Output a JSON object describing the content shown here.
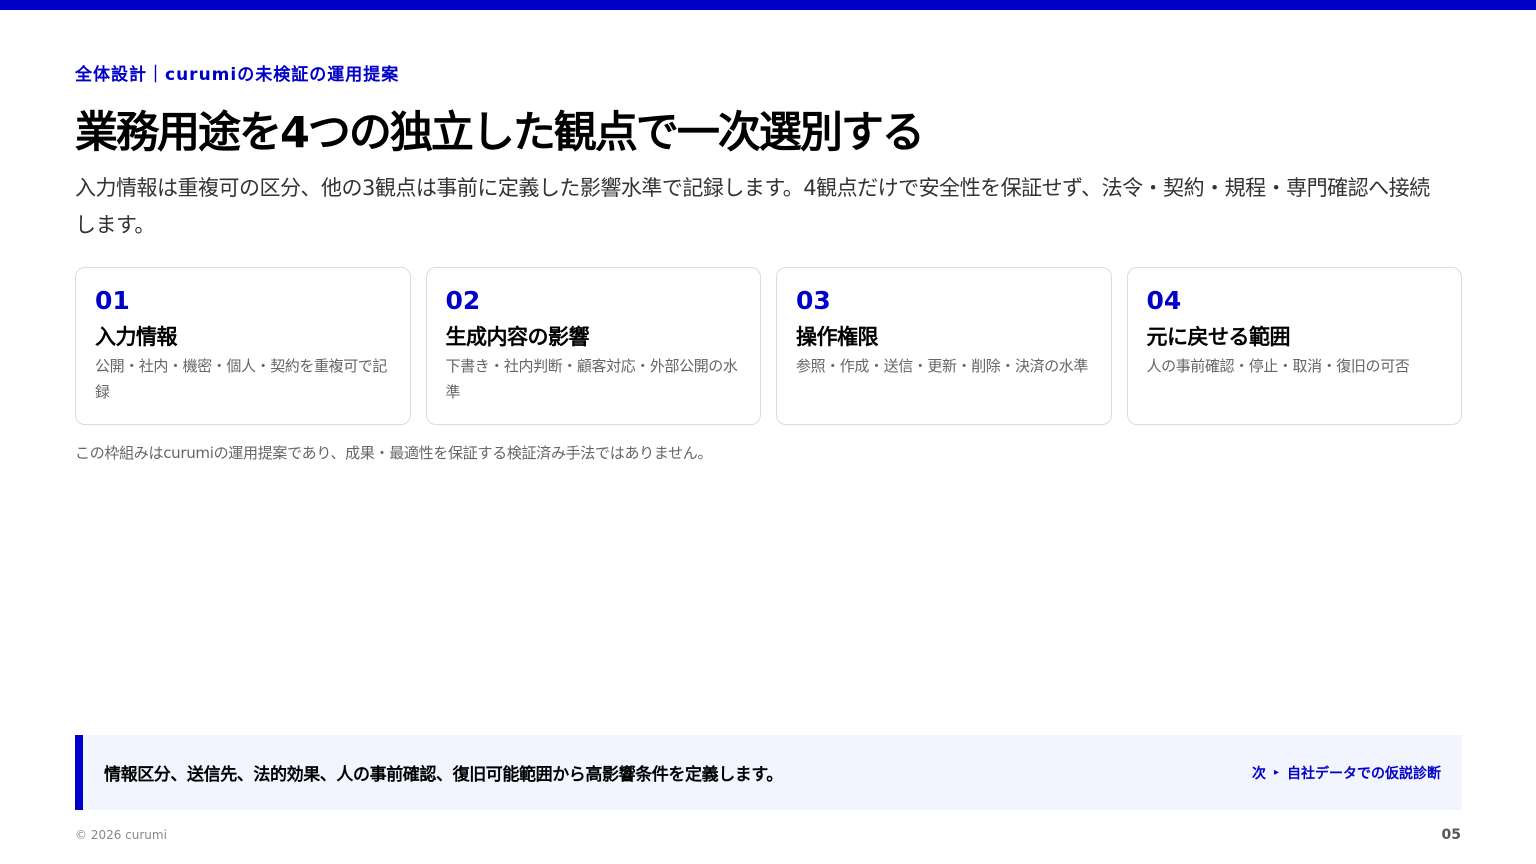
{
  "colors": {
    "accent": "#0000c8",
    "callout_bg": "#f2f5fe"
  },
  "header": {
    "eyebrow": "全体設計｜curumiの未検証の運用提案",
    "title": "業務用途を4つの独立した観点で一次選別する",
    "lead": "入力情報は重複可の区分、他の3観点は事前に定義した影響水準で記録します。4観点だけで安全性を保証せず、法令・契約・規程・専門確認へ接続します。"
  },
  "cards": [
    {
      "num": "01",
      "title": "入力情報",
      "desc": "公開・社内・機密・個人・契約を重複可で記録"
    },
    {
      "num": "02",
      "title": "生成内容の影響",
      "desc": "下書き・社内判断・顧客対応・外部公開の水準"
    },
    {
      "num": "03",
      "title": "操作権限",
      "desc": "参照・作成・送信・更新・削除・決済の水準"
    },
    {
      "num": "04",
      "title": "元に戻せる範囲",
      "desc": "人の事前確認・停止・取消・復旧の可否"
    }
  ],
  "note": "この枠組みはcurumiの運用提案であり、成果・最適性を保証する検証済み手法ではありません。",
  "callout": {
    "text": "情報区分、送信先、法的効果、人の事前確認、復旧可能範囲から高影響条件を定義します。",
    "next_prefix": "次",
    "next_icon": "▸",
    "next_label": "自社データでの仮説診断"
  },
  "footer": {
    "copyright": "© 2026 curumi",
    "page": "05"
  }
}
